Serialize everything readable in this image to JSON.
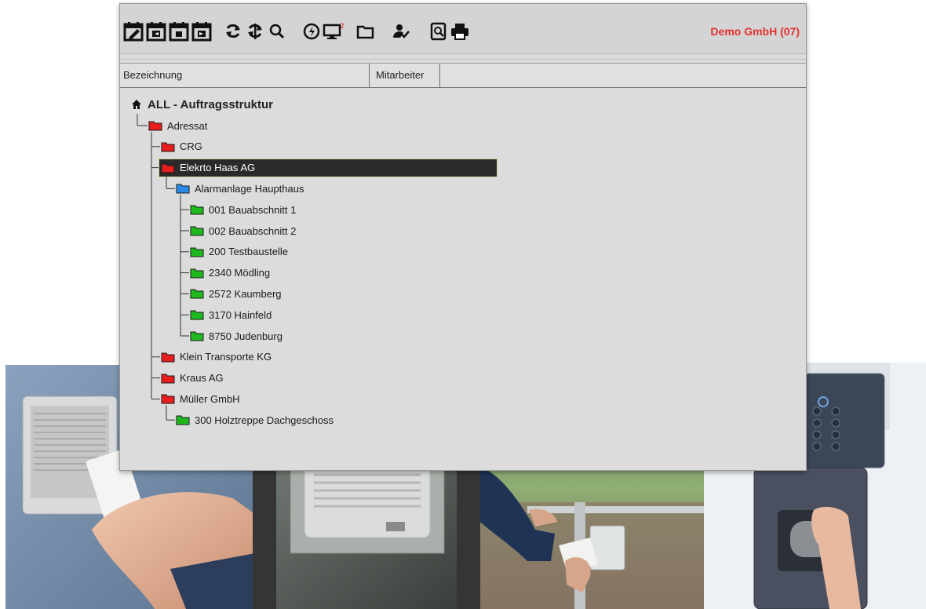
{
  "toolbar": {
    "icons": [
      "calendar-edit-icon",
      "calendar-prev-icon",
      "calendar-today-icon",
      "calendar-next-icon",
      "refresh-icon",
      "refresh-all-icon",
      "search-icon",
      "power-icon",
      "monitor-icon",
      "folder-icon",
      "user-check-icon",
      "print-preview-icon",
      "print-icon"
    ],
    "monitor_badge": "2",
    "company": "Demo GmbH (07)"
  },
  "columns": {
    "bezeichnung": "Bezeichnung",
    "mitarbeiter": "Mitarbeiter"
  },
  "tree": {
    "root": "ALL - Auftragsstruktur",
    "nodes": [
      {
        "label": "Adressat",
        "color": "#e81e1e"
      },
      {
        "label": "CRG",
        "color": "#e81e1e"
      },
      {
        "label": "Elekrto Haas AG",
        "color": "#e81e1e"
      },
      {
        "label": "Alarmanlage Haupthaus",
        "color": "#2a8ae8"
      },
      {
        "label": "001 Bauabschnitt 1",
        "color": "#1fb81f"
      },
      {
        "label": "002 Bauabschnitt 2",
        "color": "#1fb81f"
      },
      {
        "label": "200 Testbaustelle",
        "color": "#1fb81f"
      },
      {
        "label": "2340 Mödling",
        "color": "#1fb81f"
      },
      {
        "label": "2572 Kaumberg",
        "color": "#1fb81f"
      },
      {
        "label": "3170 Hainfeld",
        "color": "#1fb81f"
      },
      {
        "label": "8750 Judenburg",
        "color": "#1fb81f"
      },
      {
        "label": "Klein Transporte KG",
        "color": "#e81e1e"
      },
      {
        "label": "Kraus AG",
        "color": "#e81e1e"
      },
      {
        "label": "Müller GmbH",
        "color": "#e81e1e"
      },
      {
        "label": "300 Holztreppe Dachgeschoss",
        "color": "#1fb81f"
      }
    ],
    "selected": "Elekrto Haas AG"
  },
  "colors": {
    "company": "#e53030",
    "selection_bg": "#2a2a2a",
    "window_bg": "#dcdcdc"
  }
}
